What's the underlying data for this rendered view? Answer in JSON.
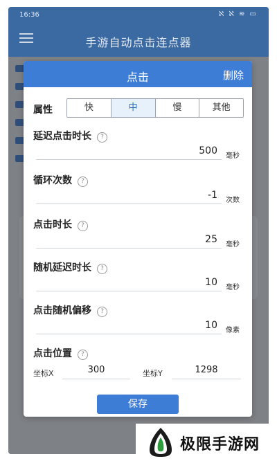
{
  "status_bar": {
    "time": "16:36",
    "icons": "ℵ ℵ ≋ ▭"
  },
  "app_bar": {
    "title": "手游自动点击连点器"
  },
  "dialog": {
    "title": "点击",
    "delete_label": "删除",
    "attribute": {
      "label": "属性",
      "options": [
        "快",
        "中",
        "慢",
        "其他"
      ],
      "selected": "中"
    },
    "fields": [
      {
        "label": "延迟点击时长",
        "value": "500",
        "unit": "毫秒"
      },
      {
        "label": "循环次数",
        "value": "-1",
        "unit": "次数"
      },
      {
        "label": "点击时长",
        "value": "25",
        "unit": "毫秒"
      },
      {
        "label": "随机延迟时长",
        "value": "10",
        "unit": "毫秒"
      },
      {
        "label": "点击随机偏移",
        "value": "10",
        "unit": "像素"
      }
    ],
    "position": {
      "label": "点击位置",
      "x_label": "坐标X",
      "x_value": "300",
      "y_label": "坐标Y",
      "y_value": "1298"
    },
    "save_label": "保存"
  },
  "watermark": {
    "text": "极限手游网"
  },
  "colors": {
    "primary": "#3d7dd6",
    "appbar": "#3b6aa3",
    "overlay": "#7e8185"
  }
}
